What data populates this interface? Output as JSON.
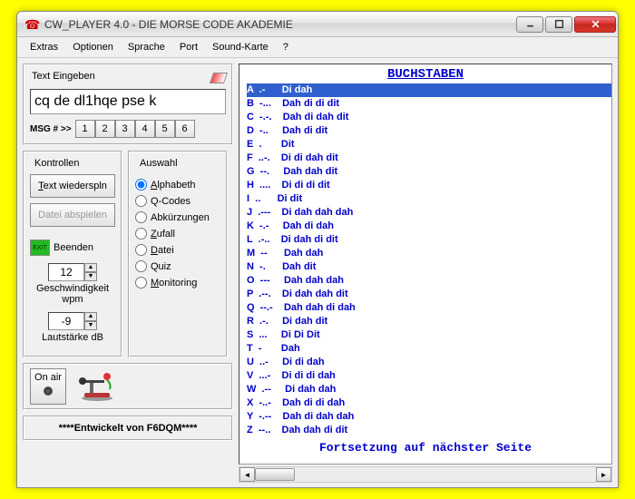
{
  "window": {
    "title": "CW_PLAYER 4.0 - DIE MORSE CODE AKADEMIE"
  },
  "menu": [
    "Extras",
    "Optionen",
    "Sprache",
    "Port",
    "Sound-Karte",
    "?"
  ],
  "textpanel": {
    "label": "Text Eingeben",
    "value": "cq de dl1hqe pse k",
    "msglabel": "MSG # >>",
    "msgbtns": [
      "1",
      "2",
      "3",
      "4",
      "5",
      "6"
    ]
  },
  "kontrollen": {
    "title": "Kontrollen",
    "replay": "Text wiederspln",
    "replay_u": "T",
    "playfile": "Datei abspielen",
    "exit": "Beenden",
    "speed": "12",
    "speedlbl": "Geschwindigkeit wpm",
    "vol": "-9",
    "vollbl": "Lautstärke dB"
  },
  "auswahl": {
    "title": "Auswahl",
    "items": [
      {
        "label": "Alphabeth",
        "u": "A",
        "sel": true
      },
      {
        "label": "Q-Codes",
        "u": "",
        "sel": false
      },
      {
        "label": "Abkürzungen",
        "u": "",
        "sel": false
      },
      {
        "label": "Zufall",
        "u": "Z",
        "sel": false
      },
      {
        "label": "Datei",
        "u": "D",
        "sel": false
      },
      {
        "label": "Quiz",
        "u": "",
        "sel": false
      },
      {
        "label": "Monitoring",
        "u": "M",
        "sel": false
      }
    ]
  },
  "onair": "On air",
  "dev": "****Entwickelt von F6DQM****",
  "list": {
    "header": "BUCHSTABEN",
    "footer": "Fortsetzung auf nächster Seite",
    "rows": [
      {
        "c": "A",
        "m": ".-",
        "t": "Di dah",
        "sel": true
      },
      {
        "c": "B",
        "m": "-...",
        "t": "Dah di di dit"
      },
      {
        "c": "C",
        "m": "-.-.",
        "t": "Dah di dah dit"
      },
      {
        "c": "D",
        "m": "-..",
        "t": "Dah di dit"
      },
      {
        "c": "E",
        "m": ".",
        "t": "Dit"
      },
      {
        "c": "F",
        "m": "..-.",
        "t": "Di di dah dit"
      },
      {
        "c": "G",
        "m": "--.",
        "t": "Dah dah dit"
      },
      {
        "c": "H",
        "m": "....",
        "t": "Di di di dit"
      },
      {
        "c": "I",
        "m": "..",
        "t": "Di dit"
      },
      {
        "c": "J",
        "m": ".---",
        "t": "Di dah dah dah"
      },
      {
        "c": "K",
        "m": "-.-",
        "t": "Dah di dah"
      },
      {
        "c": "L",
        "m": ".-..",
        "t": "Di dah di dit"
      },
      {
        "c": "M",
        "m": "--",
        "t": "Dah dah"
      },
      {
        "c": "N",
        "m": "-.",
        "t": "Dah dit"
      },
      {
        "c": "O",
        "m": "---",
        "t": "Dah dah dah"
      },
      {
        "c": "P",
        "m": ".--.",
        "t": "Di dah dah dit"
      },
      {
        "c": "Q",
        "m": "--.-",
        "t": "Dah dah di dah"
      },
      {
        "c": "R",
        "m": ".-.",
        "t": "Di dah dit"
      },
      {
        "c": "S",
        "m": "...",
        "t": "Di Di Dit"
      },
      {
        "c": "T",
        "m": "-",
        "t": "Dah"
      },
      {
        "c": "U",
        "m": "..-",
        "t": "Di di dah"
      },
      {
        "c": "V",
        "m": "...-",
        "t": "Di di di dah"
      },
      {
        "c": "W",
        "m": ".--",
        "t": "Di dah dah"
      },
      {
        "c": "X",
        "m": "-..-",
        "t": "Dah di di dah"
      },
      {
        "c": "Y",
        "m": "-.--",
        "t": "Dah di dah dah"
      },
      {
        "c": "Z",
        "m": "--..",
        "t": "Dah dah di dit"
      }
    ]
  }
}
